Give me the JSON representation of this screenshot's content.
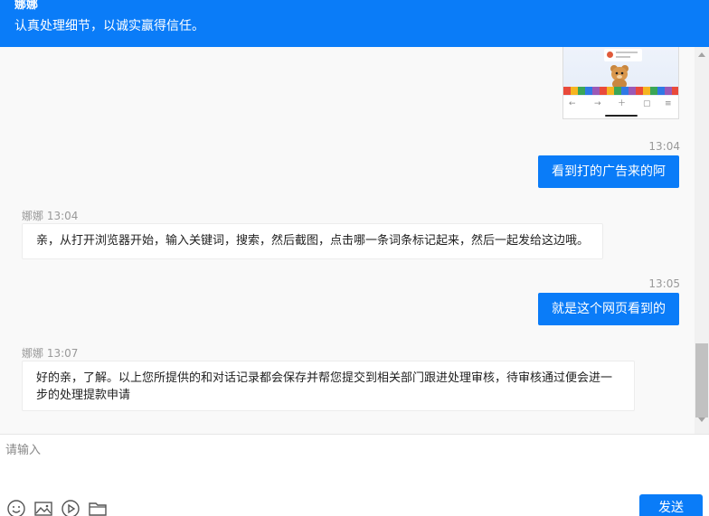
{
  "header": {
    "agent_name": "娜娜",
    "slogan": "认真处理细节，以诚实赢得信任。"
  },
  "messages": [
    {
      "sender": "user",
      "time": "13:04",
      "text": "看到打的广告来的阿"
    },
    {
      "sender": "agent",
      "name": "娜娜",
      "time": "13:04",
      "text": "亲，从打开浏览器开始，输入关键词，搜索，然后截图，点击哪一条词条标记起来，然后一起发给这边哦。"
    },
    {
      "sender": "user",
      "time": "13:05",
      "text": "就是这个网页看到的"
    },
    {
      "sender": "agent",
      "name": "娜娜",
      "time": "13:07",
      "text": "好的亲，了解。以上您所提供的和对话记录都会保存并帮您提交到相关部门跟进处理审核，待审核通过便会进一步的处理提款申请"
    }
  ],
  "composer": {
    "placeholder": "请输入",
    "send_label": "发送",
    "tools": [
      "emoji-icon",
      "image-icon",
      "video-icon",
      "folder-icon"
    ]
  },
  "colors": {
    "brand": "#0a7cf8",
    "chat_bg": "#f9f9f9",
    "meta_text": "#999999"
  }
}
